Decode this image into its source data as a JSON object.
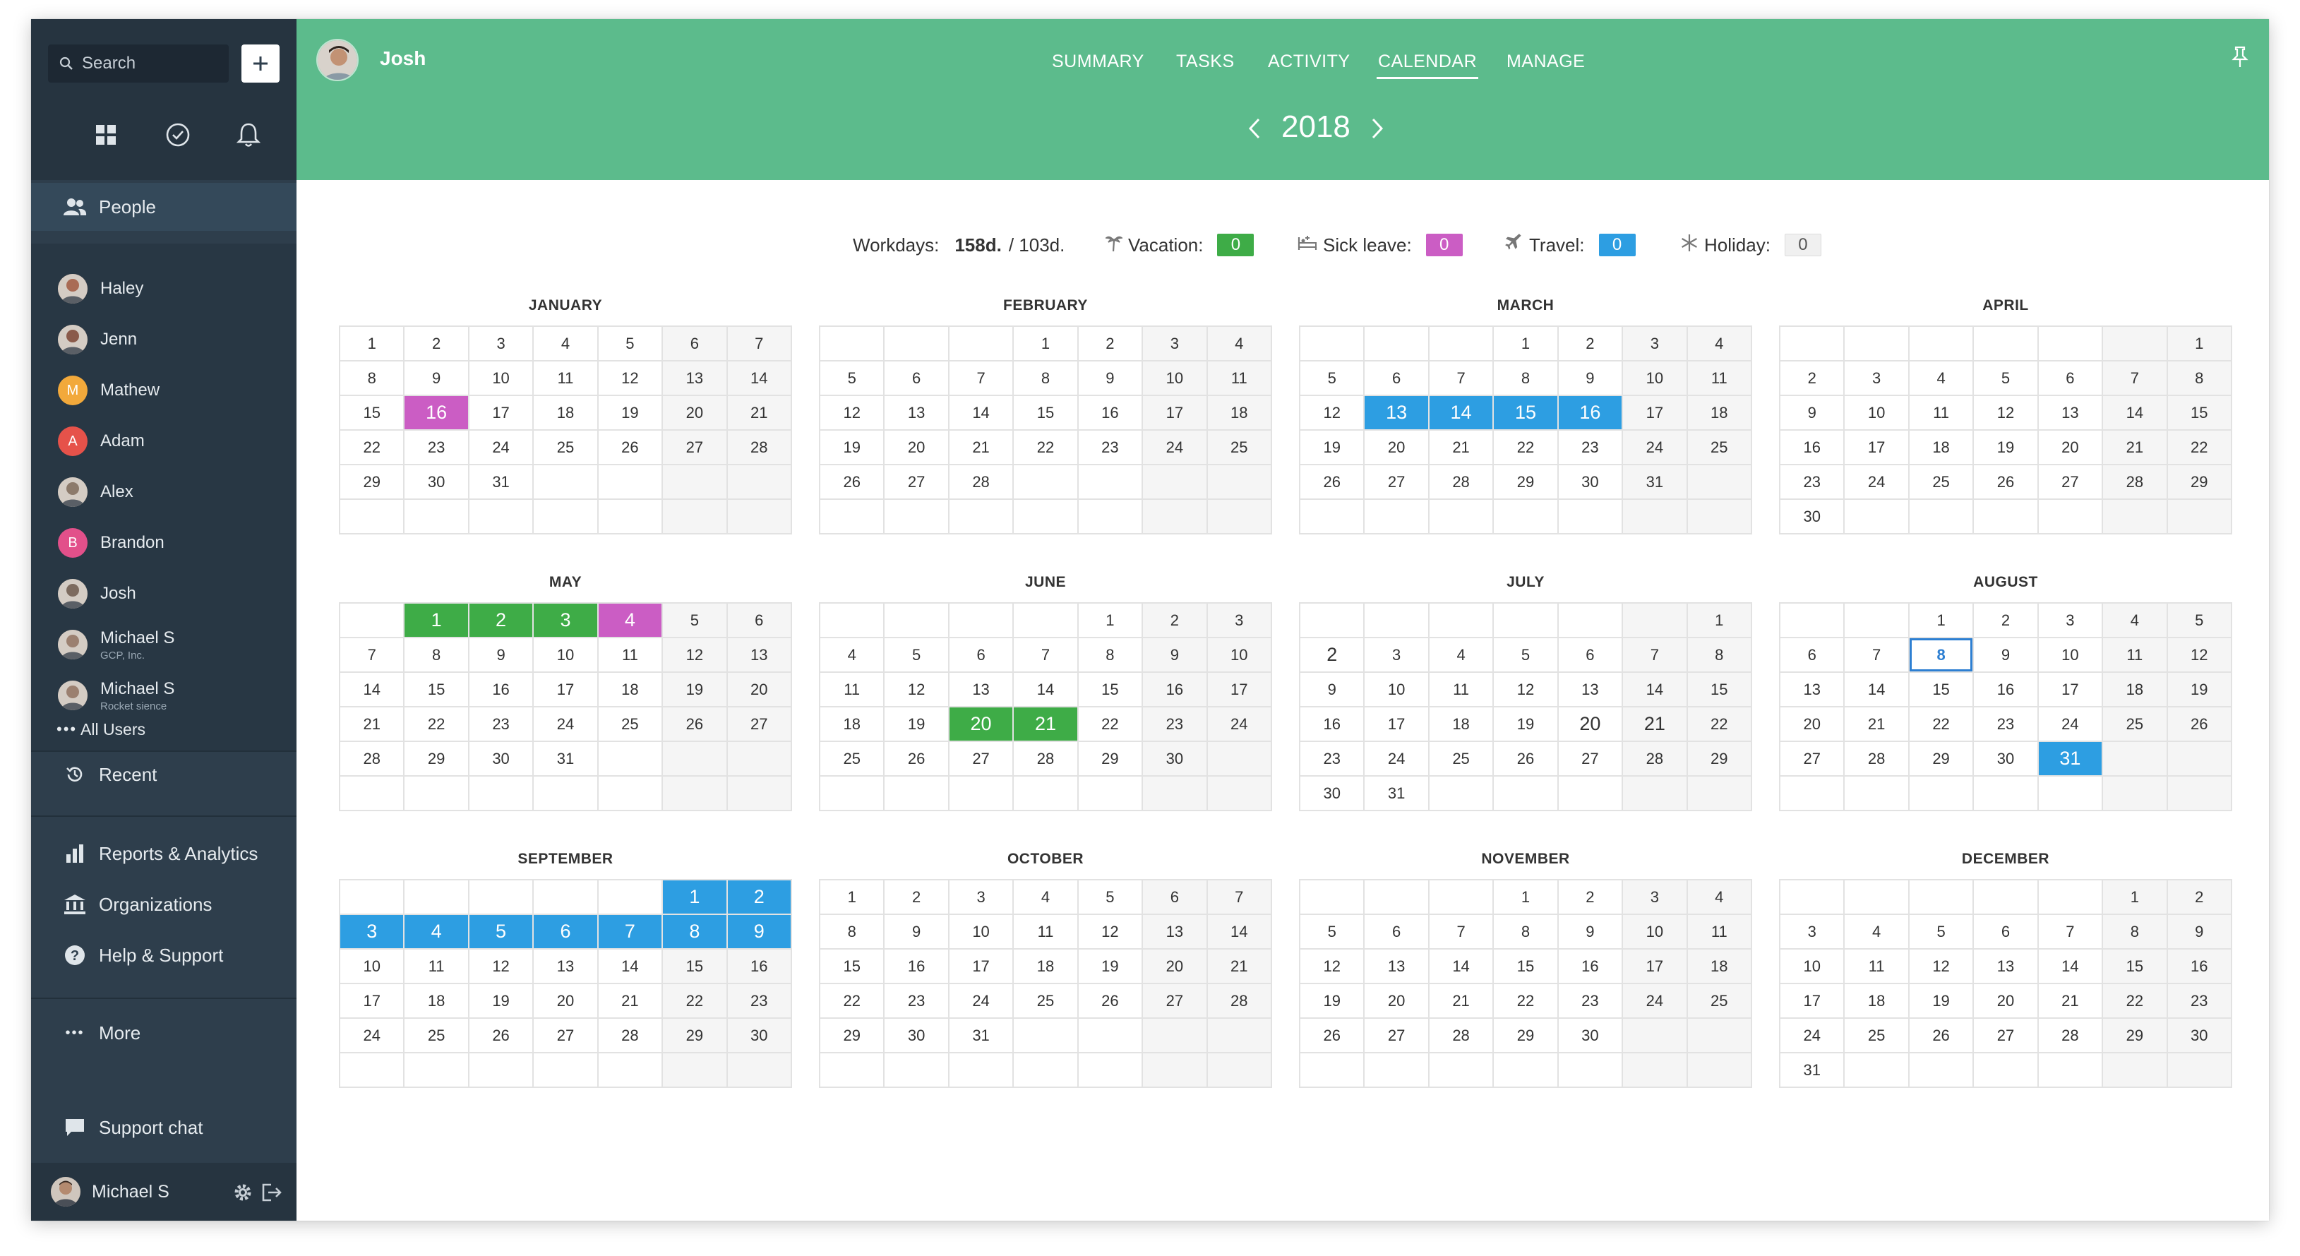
{
  "sidebar": {
    "search_placeholder": "Search",
    "people_label": "People",
    "people": [
      {
        "name": "Haley",
        "sub": "",
        "initial": "",
        "color": "#a96b55"
      },
      {
        "name": "Jenn",
        "sub": "",
        "initial": "",
        "color": "#8a5a4a"
      },
      {
        "name": "Mathew",
        "sub": "",
        "initial": "M",
        "color": "#f2a93b"
      },
      {
        "name": "Adam",
        "sub": "",
        "initial": "A",
        "color": "#e6524a"
      },
      {
        "name": "Alex",
        "sub": "",
        "initial": "",
        "color": "#8c7a6b"
      },
      {
        "name": "Brandon",
        "sub": "",
        "initial": "B",
        "color": "#e2508a"
      },
      {
        "name": "Josh",
        "sub": "",
        "initial": "",
        "color": "#7d6b5f"
      },
      {
        "name": "Michael S",
        "sub": "GCP, Inc.",
        "initial": "",
        "color": "#9b8070"
      },
      {
        "name": "Michael S",
        "sub": "Rocket sience",
        "initial": "",
        "color": "#9b8070"
      }
    ],
    "all_users": "All Users",
    "recent": "Recent",
    "reports": "Reports & Analytics",
    "organizations": "Organizations",
    "help": "Help & Support",
    "more": "More",
    "support_chat": "Support chat",
    "current_user": "Michael S"
  },
  "header": {
    "user_name": "Josh",
    "nav": [
      "SUMMARY",
      "TASKS",
      "ACTIVITY",
      "CALENDAR",
      "MANAGE"
    ],
    "active_nav": "CALENDAR",
    "year": "2018",
    "accent": "#5cbb8c"
  },
  "summary": {
    "workdays_label": "Workdays:",
    "workdays_value": "158d.",
    "workdays_total": "/ 103d.",
    "vacation_label": "Vacation:",
    "vacation_value": "0",
    "sick_label": "Sick leave:",
    "sick_value": "0",
    "travel_label": "Travel:",
    "travel_value": "0",
    "holiday_label": "Holiday:",
    "holiday_value": "0"
  },
  "legend_colors": {
    "vacation": "#3eac47",
    "sick": "#cb5dc4",
    "travel": "#2d9ee2",
    "holiday": "#f0f0f0"
  },
  "calendar": {
    "months": [
      {
        "name": "JANUARY",
        "offset": 0,
        "days": 31,
        "vacation": [],
        "sick": [
          16
        ],
        "travel": [],
        "today": null,
        "big": []
      },
      {
        "name": "FEBRUARY",
        "offset": 3,
        "days": 28,
        "vacation": [],
        "sick": [],
        "travel": [],
        "today": null,
        "big": []
      },
      {
        "name": "MARCH",
        "offset": 3,
        "days": 31,
        "vacation": [],
        "sick": [],
        "travel": [
          13,
          14,
          15,
          16
        ],
        "today": null,
        "big": []
      },
      {
        "name": "APRIL",
        "offset": 6,
        "days": 30,
        "vacation": [],
        "sick": [],
        "travel": [],
        "today": null,
        "big": []
      },
      {
        "name": "MAY",
        "offset": 1,
        "days": 31,
        "vacation": [
          1,
          2,
          3
        ],
        "sick": [
          4
        ],
        "travel": [],
        "today": null,
        "big": []
      },
      {
        "name": "JUNE",
        "offset": 4,
        "days": 30,
        "vacation": [
          20,
          21
        ],
        "sick": [],
        "travel": [],
        "today": null,
        "big": []
      },
      {
        "name": "JULY",
        "offset": 6,
        "days": 31,
        "vacation": [],
        "sick": [],
        "travel": [],
        "today": null,
        "big": [
          2,
          20,
          21
        ]
      },
      {
        "name": "AUGUST",
        "offset": 2,
        "days": 31,
        "vacation": [],
        "sick": [],
        "travel": [
          31
        ],
        "today": 8,
        "big": []
      },
      {
        "name": "SEPTEMBER",
        "offset": 5,
        "days": 30,
        "vacation": [],
        "sick": [],
        "travel": [
          1,
          2,
          3,
          4,
          5,
          6,
          7,
          8,
          9
        ],
        "today": null,
        "big": []
      },
      {
        "name": "OCTOBER",
        "offset": 0,
        "days": 31,
        "vacation": [],
        "sick": [],
        "travel": [],
        "today": null,
        "big": []
      },
      {
        "name": "NOVEMBER",
        "offset": 3,
        "days": 30,
        "vacation": [],
        "sick": [],
        "travel": [],
        "today": null,
        "big": []
      },
      {
        "name": "DECEMBER",
        "offset": 5,
        "days": 31,
        "vacation": [],
        "sick": [],
        "travel": [],
        "today": null,
        "big": []
      }
    ]
  }
}
